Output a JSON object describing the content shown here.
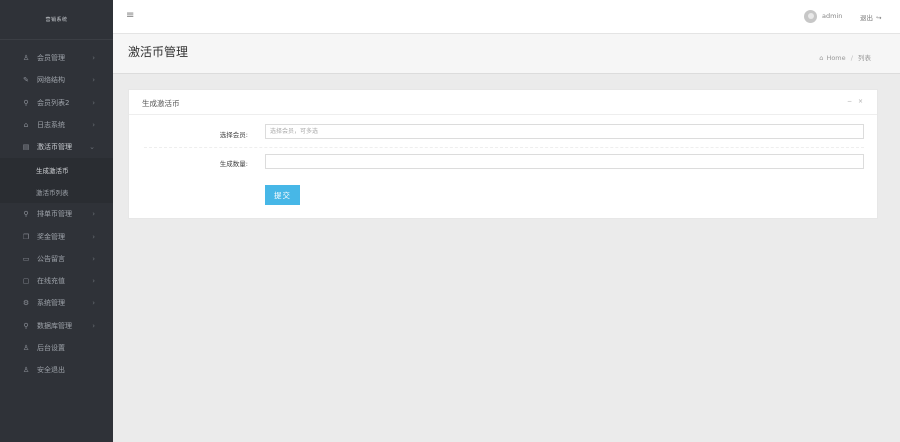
{
  "sidebar": {
    "title": "营销系统",
    "items": [
      {
        "icon": "♙",
        "label": "会员管理",
        "chevron": "›"
      },
      {
        "icon": "✎",
        "label": "网络结构",
        "chevron": "›"
      },
      {
        "icon": "⚲",
        "label": "会员列表2",
        "chevron": "›"
      },
      {
        "icon": "⌂",
        "label": "日志系统",
        "chevron": "›"
      },
      {
        "icon": "▤",
        "label": "激活币管理",
        "chevron": "⌄"
      }
    ],
    "submenu": [
      {
        "label": "生成激活币"
      },
      {
        "label": "激活币列表"
      }
    ],
    "items2": [
      {
        "icon": "⚲",
        "label": "排单币管理",
        "chevron": "›"
      },
      {
        "icon": "❐",
        "label": "奖金管理",
        "chevron": "›"
      },
      {
        "icon": "▭",
        "label": "公告留言",
        "chevron": "›"
      },
      {
        "icon": "▢",
        "label": "在线充值",
        "chevron": "›"
      },
      {
        "icon": "⚙",
        "label": "系统管理",
        "chevron": "›"
      },
      {
        "icon": "⚲",
        "label": "数据库管理",
        "chevron": "›"
      },
      {
        "icon": "♙",
        "label": "后台设置",
        "chevron": ""
      },
      {
        "icon": "♙",
        "label": "安全退出",
        "chevron": ""
      }
    ]
  },
  "topbar": {
    "menu_icon": "≡",
    "username": "admin",
    "logout_label": "退出",
    "logout_icon": "↪"
  },
  "page": {
    "title": "激活币管理",
    "breadcrumb": {
      "home_icon": "⌂",
      "home": "Home",
      "sep": "/",
      "current": "列表"
    }
  },
  "panel": {
    "title": "生成激活币",
    "tools": {
      "collapse": "−",
      "close": "×"
    },
    "form": {
      "member_label": "选择会员:",
      "member_placeholder": "选择会员，可多选",
      "qty_label": "生成数量:",
      "qty_value": "",
      "submit_label": "提交"
    }
  }
}
